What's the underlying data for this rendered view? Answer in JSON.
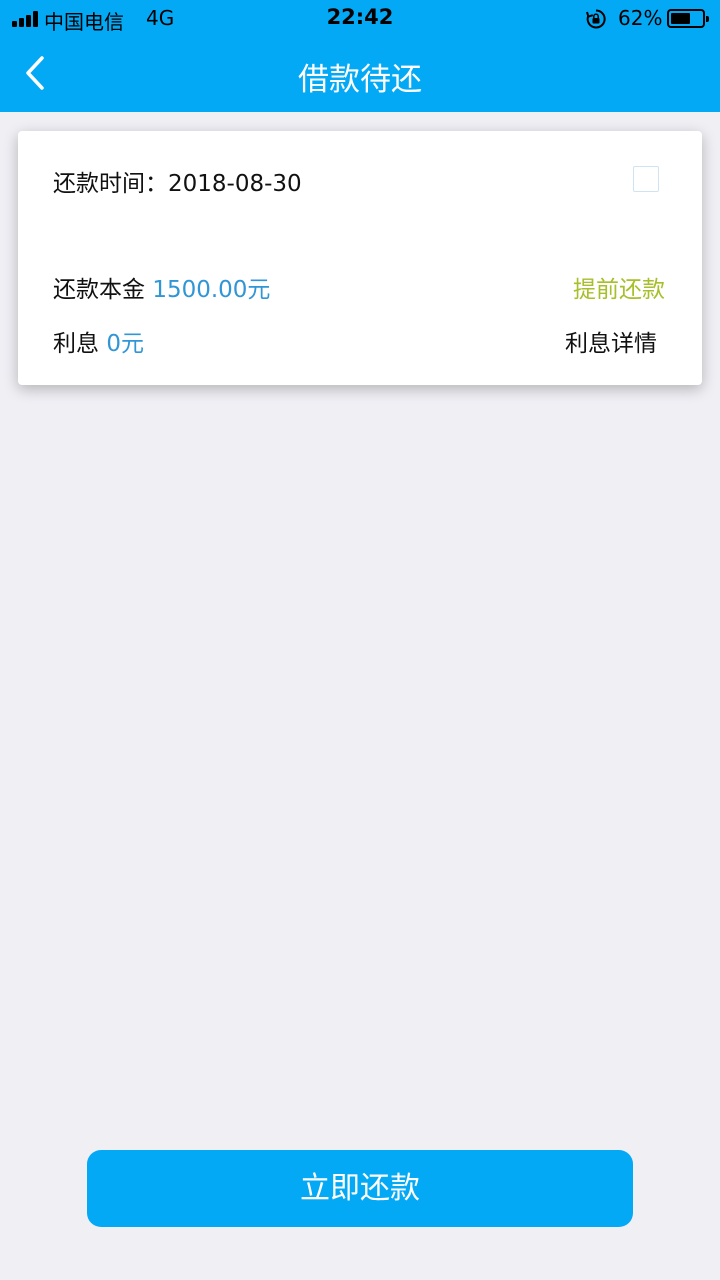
{
  "status_bar": {
    "carrier": "中国电信",
    "network": "4G",
    "time": "22:42",
    "battery_percent": "62%",
    "battery_level": 0.62
  },
  "nav": {
    "title": "借款待还",
    "back_icon": "chevron-left-icon"
  },
  "loan_card": {
    "due_label": "还款时间：",
    "due_date": "2018-08-30",
    "principal_label": "还款本金",
    "principal_value": "1500.00元",
    "interest_label": "利息",
    "interest_value": "0元",
    "prepay_label": "提前还款",
    "interest_detail_label": "利息详情",
    "checkbox_checked": false
  },
  "footer": {
    "repay_now_label": "立即还款"
  },
  "colors": {
    "brand": "#03a9f4",
    "value_blue": "#3096d6",
    "prepay_green": "#a6bf2a",
    "background": "#efeff4"
  }
}
